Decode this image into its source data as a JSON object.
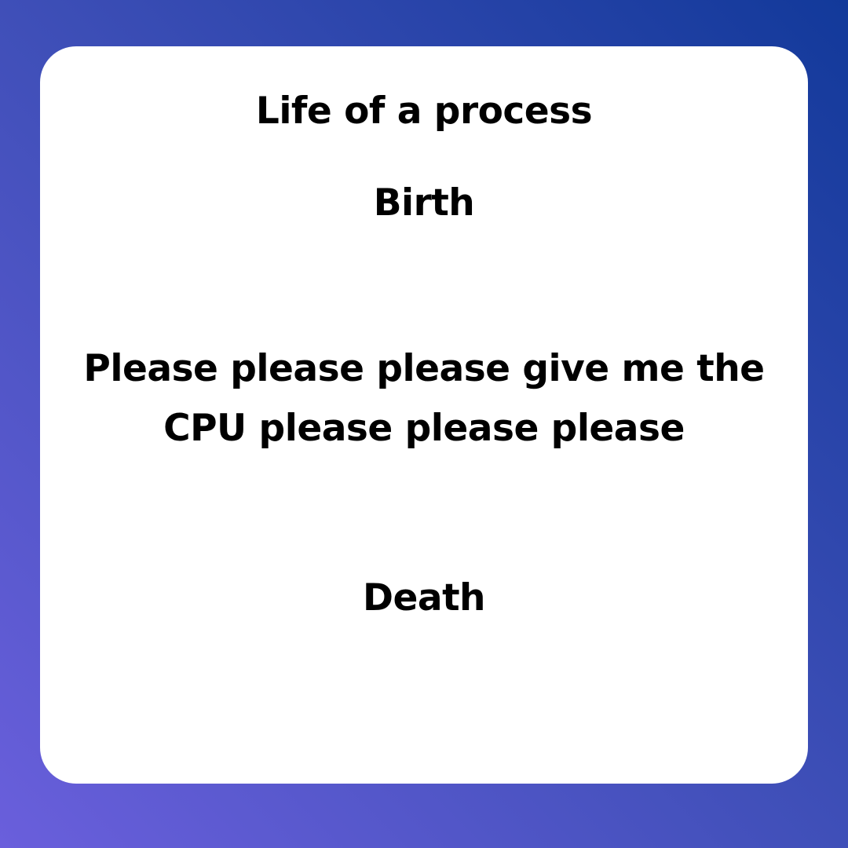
{
  "title": "Life of a process",
  "stages": {
    "birth": "Birth",
    "plea_line_1": "Please please please give me the",
    "plea_line_2": "CPU please please please",
    "death": "Death"
  },
  "colors": {
    "gradient_start": "#6a5fdc",
    "gradient_end": "#12399a",
    "card": "#ffffff",
    "text": "#000000"
  }
}
